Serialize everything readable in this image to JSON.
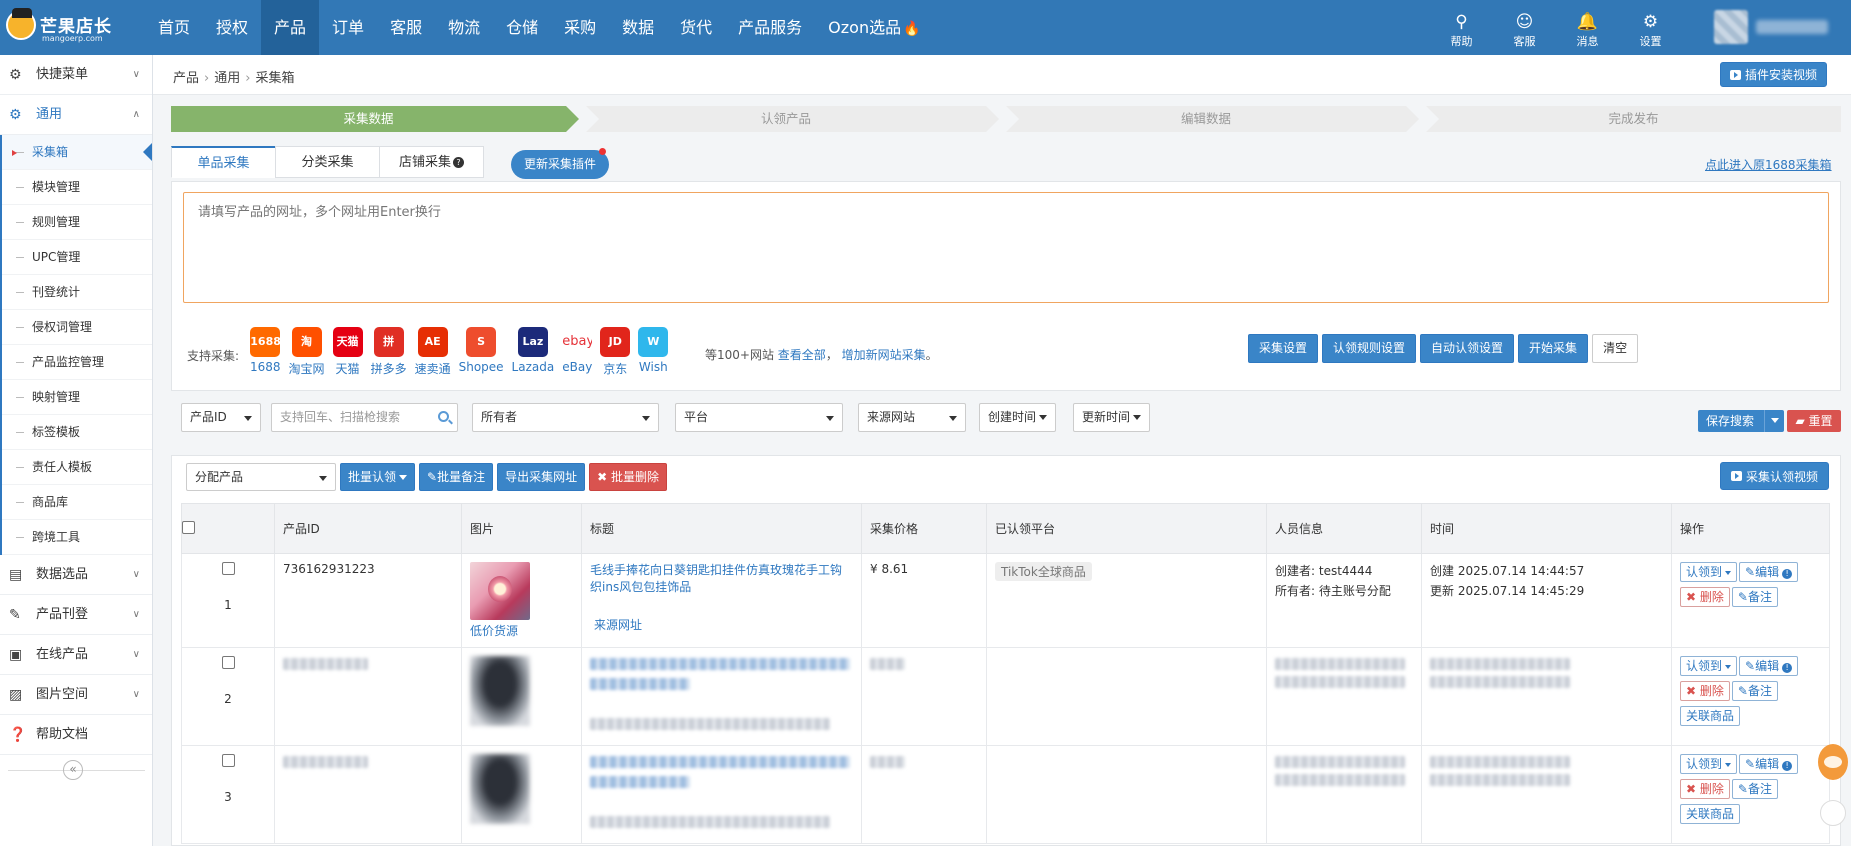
{
  "logo": {
    "name": "芒果店长",
    "sub": "mangoerp.com"
  },
  "nav": {
    "items": [
      "首页",
      "授权",
      "产品",
      "订单",
      "客服",
      "物流",
      "仓储",
      "采购",
      "数据",
      "货代",
      "产品服务",
      "Ozon选品"
    ],
    "active": "产品"
  },
  "tools": {
    "help": "帮助",
    "service": "客服",
    "message": "消息",
    "settings": "设置"
  },
  "sidebar": {
    "groups": {
      "quick": "快捷菜单",
      "general": "通用",
      "data_selection": "数据选品",
      "product_listing": "产品刊登",
      "online_products": "在线产品",
      "image_space": "图片空间",
      "help_docs": "帮助文档"
    },
    "sub_items": [
      "采集箱",
      "模块管理",
      "规则管理",
      "UPC管理",
      "刊登统计",
      "侵权词管理",
      "产品监控管理",
      "映射管理",
      "标签模板",
      "责任人模板",
      "商品库",
      "跨境工具"
    ],
    "active_sub": "采集箱"
  },
  "breadcrumb": [
    "产品",
    "通用",
    "采集箱"
  ],
  "plugin_video_label": "插件安装视频",
  "steps": [
    "采集数据",
    "认领产品",
    "编辑数据",
    "完成发布"
  ],
  "tabs": {
    "single": "单品采集",
    "category": "分类采集",
    "store": "店铺采集"
  },
  "update_plugin_label": "更新采集插件",
  "orig_1688_link": "点此进入原1688采集箱",
  "url_input": {
    "placeholder": "请填写产品的网址，多个网址用Enter换行"
  },
  "support_label": "支持采集:",
  "platforms": [
    {
      "name": "1688",
      "color": "#ff6a00",
      "glyph": "1688"
    },
    {
      "name": "淘宝网",
      "color": "#ff5000",
      "glyph": "淘"
    },
    {
      "name": "天猫",
      "color": "#e50012",
      "glyph": "天猫"
    },
    {
      "name": "拼多多",
      "color": "#e02e24",
      "glyph": "拼"
    },
    {
      "name": "速卖通",
      "color": "#e62e04",
      "glyph": "AE"
    },
    {
      "name": "Shopee",
      "color": "#ee4d2d",
      "glyph": "S"
    },
    {
      "name": "Lazada",
      "color": "#1c2a7a",
      "glyph": "Laz"
    },
    {
      "name": "eBay",
      "color": "#ffffff",
      "glyph": "ebay"
    },
    {
      "name": "京东",
      "color": "#e1251b",
      "glyph": "JD"
    },
    {
      "name": "Wish",
      "color": "#2fb7ec",
      "glyph": "W"
    }
  ],
  "more": {
    "prefix": "等100+网站",
    "view_all": "查看全部",
    "sep": "，",
    "add_site": "增加新网站采集",
    "end": "。"
  },
  "collect_actions": {
    "settings": "采集设置",
    "claim_rules": "认领规则设置",
    "auto_claim": "自动认领设置",
    "start": "开始采集",
    "clear": "清空"
  },
  "filters": {
    "product_id": "产品ID",
    "search_placeholder": "支持回车、扫描枪搜索",
    "owner": "所有者",
    "platform": "平台",
    "source_site": "来源网站",
    "created_time": "创建时间",
    "updated_time": "更新时间",
    "save_search": "保存搜索",
    "reset": "重置"
  },
  "assign_select": "分配产品",
  "batch": {
    "claim": "批量认领",
    "note": "批量备注",
    "export": "导出采集网址",
    "delete": "批量删除"
  },
  "claim_video_label": "采集认领视频",
  "table": {
    "headers": [
      "产品ID",
      "图片",
      "标题",
      "采集价格",
      "已认领平台",
      "人员信息",
      "时间",
      "操作"
    ],
    "rows": [
      {
        "no": "1",
        "id": "736162931223",
        "img_tag": "低价货源",
        "title": "毛线手捧花向日葵钥匙扣挂件仿真玫瑰花手工钩织ins风包包挂饰品",
        "source_link": "来源网址",
        "price": "¥ 8.61",
        "claimed": "TikTok全球商品",
        "creator": "创建者:  test4444",
        "owner": "所有者:  待主账号分配",
        "created": "创建 2025.07.14 14:44:57",
        "updated": "更新 2025.07.14 14:45:29"
      },
      {
        "no": "2"
      },
      {
        "no": "3"
      }
    ],
    "ops": {
      "claim_to": "认领到",
      "edit": "编辑",
      "delete": "删除",
      "note": "备注",
      "link": "关联商品"
    }
  }
}
